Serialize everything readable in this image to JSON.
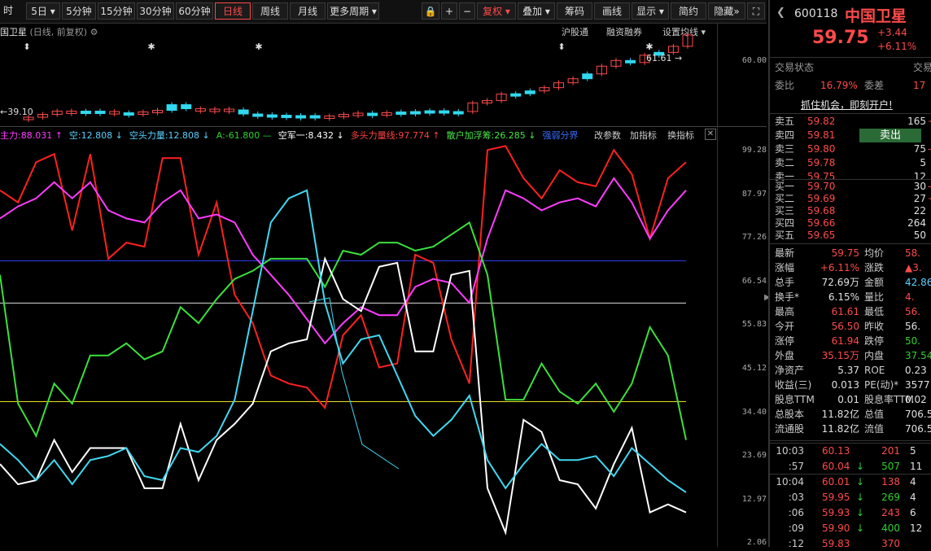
{
  "toolbar": {
    "periods": [
      "时",
      "5日",
      "5分钟",
      "15分钟",
      "30分钟",
      "60分钟",
      "日线",
      "周线",
      "月线",
      "更多周期"
    ],
    "active_period": "日线",
    "tools": [
      "复权",
      "叠加",
      "筹码",
      "画线",
      "显示",
      "简约",
      "隐藏"
    ]
  },
  "kline": {
    "title": "国卫星",
    "subtitle": "(日线, 前复权)",
    "links": [
      "沪股通",
      "融资融券",
      "设置均线"
    ],
    "high_label": "61.61",
    "low_label": "39.10",
    "closes": [
      39.5,
      40.2,
      41.0,
      40.5,
      41.0,
      40.9,
      40.6,
      40.4,
      40.8,
      41.2,
      42.6,
      41.6,
      41.1,
      41.5,
      41.3,
      40.3,
      40.1,
      40.0,
      39.9,
      39.9,
      39.6,
      39.8,
      40.2,
      40.5,
      40.4,
      40.6,
      40.8,
      40.9,
      41.1,
      40.8,
      40.9,
      43.0,
      43.6,
      45.2,
      45.3,
      46.0,
      46.8,
      48.0,
      49.0,
      50.2,
      52.1,
      53.5,
      53.0,
      54.8,
      55.5,
      57.0,
      59.8
    ],
    "colors": [
      "up",
      "up",
      "up",
      "up",
      "down",
      "down",
      "up",
      "down",
      "up",
      "up",
      "down",
      "down",
      "up",
      "up",
      "up",
      "down",
      "down",
      "down",
      "down",
      "down",
      "down",
      "up",
      "up",
      "up",
      "down",
      "up",
      "down",
      "down",
      "down",
      "down",
      "down",
      "up",
      "up",
      "up",
      "down",
      "down",
      "up",
      "up",
      "up",
      "down",
      "up",
      "up",
      "down",
      "up",
      "down",
      "up",
      "up"
    ]
  },
  "axis": {
    "top": [
      "60.00"
    ],
    "bottom": [
      "99.28",
      "87.97",
      "77.26",
      "66.54",
      "55.83",
      "45.12",
      "34.40",
      "23.69",
      "12.97",
      "2.06"
    ]
  },
  "indicator": {
    "labels": [
      {
        "text": "主力:88.031 ↑",
        "color": "#ff3cff"
      },
      {
        "text": "空:12.808 ↓",
        "color": "#5ad0ff"
      },
      {
        "text": "空头力量:12.808 ↓",
        "color": "#5ad0ff"
      },
      {
        "text": "A:-61.800 —",
        "color": "#2fd02f"
      },
      {
        "text": "空军一:8.432 ↓",
        "color": "#ffffff"
      },
      {
        "text": "多头力量线:97.774 ↑",
        "color": "#ff4040"
      },
      {
        "text": "散户加浮筹:26.285 ↓",
        "color": "#48e848"
      },
      {
        "text": "强弱分界",
        "color": "#3a6cff"
      }
    ],
    "actions": [
      "改参数",
      "加指标",
      "换指标"
    ],
    "ymin": 2.06,
    "ymax": 99.28,
    "hlines": [
      {
        "value": 70.5,
        "color": "#3040ff"
      },
      {
        "value": 60.0,
        "color": "#dddddd"
      },
      {
        "value": 35.5,
        "color": "#e8e020"
      }
    ],
    "series": [
      {
        "name": "多头力量线",
        "color": "#ff2020",
        "values": [
          88,
          85,
          95,
          97,
          78,
          97,
          71,
          75,
          74,
          96,
          96,
          72,
          85,
          62,
          55,
          42,
          40,
          39,
          34,
          52,
          57,
          44,
          45,
          72,
          70,
          51,
          40,
          98,
          99,
          91,
          86,
          93,
          90,
          89,
          98,
          92,
          76,
          91,
          95
        ]
      },
      {
        "name": "主力",
        "color": "#ff3cff",
        "values": [
          81,
          84,
          86,
          90,
          86,
          90,
          83,
          81,
          80,
          85,
          88,
          81,
          82,
          80,
          72,
          67,
          62,
          56,
          50,
          55,
          59,
          57,
          57,
          64,
          66,
          65,
          60,
          76,
          88,
          86,
          83,
          85,
          86,
          84,
          91,
          85,
          76,
          83,
          88
        ]
      },
      {
        "name": "散户加浮筹",
        "color": "#3ce03c",
        "values": [
          67,
          35,
          27,
          40,
          35,
          47,
          47,
          50,
          46,
          48,
          59,
          55,
          61,
          66,
          68,
          71,
          71,
          71,
          64,
          73,
          72,
          75,
          75,
          73,
          74,
          77,
          80,
          67,
          36,
          36,
          45,
          38,
          35,
          40,
          33,
          40,
          54,
          47,
          26
        ]
      },
      {
        "name": "空军一",
        "color": "#ffffff",
        "values": [
          20,
          15,
          16,
          26,
          18,
          24,
          24,
          24,
          14,
          14,
          30,
          16,
          26,
          30,
          35,
          48,
          50,
          51,
          71,
          61,
          58,
          69,
          70,
          48,
          48,
          67,
          68,
          14,
          3,
          31,
          28,
          16,
          15,
          9,
          20,
          29,
          8,
          10,
          8
        ]
      },
      {
        "name": "空",
        "color": "#40d8f0",
        "values": [
          25,
          21,
          16,
          21,
          15,
          21,
          22,
          24,
          17,
          16,
          24,
          23,
          27,
          36,
          58,
          80,
          86,
          88,
          60,
          45,
          51,
          52,
          42,
          32,
          27,
          31,
          37,
          21,
          14,
          20,
          25,
          21,
          21,
          22,
          17,
          24,
          20,
          16,
          13
        ]
      }
    ]
  },
  "panel": {
    "code": "600118",
    "name": "中国卫星",
    "price": "59.75",
    "change": "+3.44",
    "change_pct": "+6.11%",
    "trade_status_label": "交易状态",
    "trade_status_label2": "交易",
    "wb_label": "委比",
    "wb_value": "16.79%",
    "wc_label": "委差",
    "wc_value": "17",
    "banner": "抓住机会，即刻开户!",
    "sell": [
      {
        "label": "卖五",
        "price": "59.82",
        "vol": "165",
        "ext": "+1"
      },
      {
        "label": "卖四",
        "price": "59.81",
        "vol": "",
        "ext": ""
      },
      {
        "label": "卖三",
        "price": "59.80",
        "vol": "75",
        "ext": "-"
      },
      {
        "label": "卖二",
        "price": "59.78",
        "vol": "5",
        "ext": ""
      },
      {
        "label": "卖一",
        "price": "59.75",
        "vol": "12",
        "ext": ""
      }
    ],
    "sell_button": "卖出",
    "buy": [
      {
        "label": "买一",
        "price": "59.70",
        "vol": "30",
        "ext": "-"
      },
      {
        "label": "买二",
        "price": "59.69",
        "vol": "27",
        "ext": "+"
      },
      {
        "label": "买三",
        "price": "59.68",
        "vol": "22",
        "ext": ""
      },
      {
        "label": "买四",
        "price": "59.66",
        "vol": "264",
        "ext": ""
      },
      {
        "label": "买五",
        "price": "59.65",
        "vol": "50",
        "ext": ""
      }
    ],
    "stats": [
      {
        "l1": "最新",
        "v1": "59.75",
        "c1": "r",
        "l2": "均价",
        "v2": "58.",
        "c2": "r"
      },
      {
        "l1": "涨幅",
        "v1": "+6.11%",
        "c1": "r",
        "l2": "涨跌",
        "v2": "▲3.",
        "c2": "r"
      },
      {
        "l1": "总手",
        "v1": "72.69万",
        "c1": "w",
        "l2": "金额",
        "v2": "42.86",
        "c2": "c"
      },
      {
        "l1": "换手*",
        "v1": "6.15%",
        "c1": "w",
        "l2": "量比",
        "v2": "4.",
        "c2": "r"
      },
      {
        "l1": "最高",
        "v1": "61.61",
        "c1": "r",
        "l2": "最低",
        "v2": "56.",
        "c2": "r"
      },
      {
        "l1": "今开",
        "v1": "56.50",
        "c1": "r",
        "l2": "昨收",
        "v2": "56.",
        "c2": "w"
      },
      {
        "l1": "涨停",
        "v1": "61.94",
        "c1": "r",
        "l2": "跌停",
        "v2": "50.",
        "c2": "g"
      },
      {
        "l1": "外盘",
        "v1": "35.15万",
        "c1": "r",
        "l2": "内盘",
        "v2": "37.54",
        "c2": "g"
      },
      {
        "l1": "净资产",
        "v1": "5.37",
        "c1": "w",
        "l2": "ROE",
        "v2": "0.23",
        "c2": "w"
      },
      {
        "l1": "收益(三)",
        "v1": "0.013",
        "c1": "w",
        "l2": "PE(动)*",
        "v2": "3577",
        "c2": "w"
      },
      {
        "l1": "股息TTM",
        "v1": "0.01",
        "c1": "w",
        "l2": "股息率TTM",
        "v2": "0.02",
        "c2": "w"
      },
      {
        "l1": "总股本",
        "v1": "11.82亿",
        "c1": "w",
        "l2": "总值",
        "v2": "706.5",
        "c2": "w"
      },
      {
        "l1": "流通股",
        "v1": "11.82亿",
        "c1": "w",
        "l2": "流值",
        "v2": "706.5",
        "c2": "w"
      }
    ],
    "ticks": [
      {
        "time": "10:03",
        "price": "60.13",
        "arrow": "",
        "vol": "201",
        "ext": "5"
      },
      {
        "time": ":57",
        "price": "60.04",
        "arrow": "↓",
        "vol": "507",
        "ext": "11"
      },
      {
        "time": "10:04",
        "price": "60.01",
        "arrow": "↓",
        "vol": "138",
        "ext": "4"
      },
      {
        "time": ":03",
        "price": "59.95",
        "arrow": "↓",
        "vol": "269",
        "ext": "4"
      },
      {
        "time": ":06",
        "price": "59.93",
        "arrow": "↓",
        "vol": "243",
        "ext": "6"
      },
      {
        "time": ":09",
        "price": "59.90",
        "arrow": "↓",
        "vol": "400",
        "ext": "12"
      },
      {
        "time": ":12",
        "price": "59.83",
        "arrow": "",
        "vol": "370",
        "ext": ""
      }
    ]
  }
}
